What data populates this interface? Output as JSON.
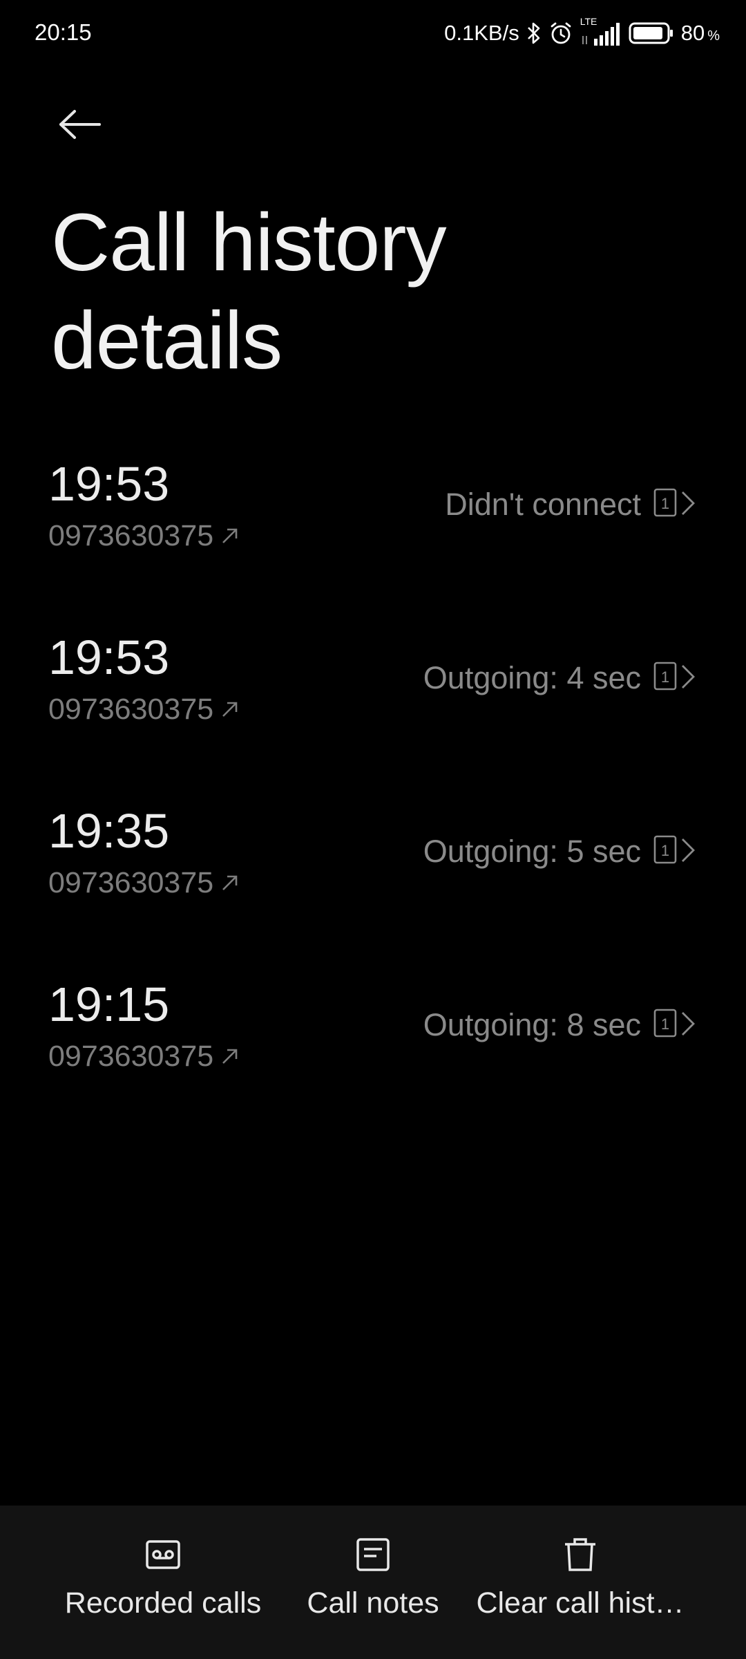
{
  "status_bar": {
    "time": "20:15",
    "network_speed": "0.1KB/s",
    "network_type": "LTE",
    "battery_level": "80",
    "battery_unit": "%",
    "icons": [
      "bluetooth-icon",
      "alarm-icon",
      "signal-icon",
      "battery-icon"
    ]
  },
  "header": {
    "back_icon": "arrow-left-icon",
    "title": "Call history details"
  },
  "calls": [
    {
      "time": "19:53",
      "number": "0973630375",
      "status": "Didn't connect",
      "sim": "1",
      "direction": "outgoing"
    },
    {
      "time": "19:53",
      "number": "0973630375",
      "status": "Outgoing: 4 sec",
      "sim": "1",
      "direction": "outgoing"
    },
    {
      "time": "19:35",
      "number": "0973630375",
      "status": "Outgoing: 5 sec",
      "sim": "1",
      "direction": "outgoing"
    },
    {
      "time": "19:15",
      "number": "0973630375",
      "status": "Outgoing: 8 sec",
      "sim": "1",
      "direction": "outgoing"
    }
  ],
  "bottom_bar": {
    "recorded_calls": "Recorded calls",
    "call_notes": "Call notes",
    "clear_history": "Clear call hist…"
  },
  "colors": {
    "background": "#000000",
    "bottom_bar": "#131313",
    "primary_text": "#ececec",
    "secondary_text": "#7d7d7d"
  }
}
